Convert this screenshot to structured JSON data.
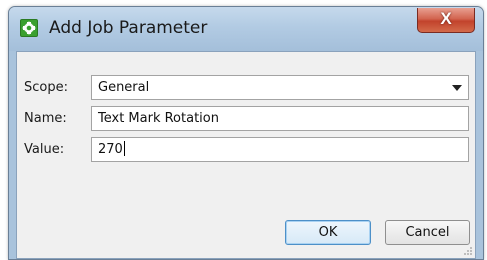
{
  "window": {
    "title": "Add Job Parameter",
    "close_glyph": "X",
    "app_icon": "green-gear-icon"
  },
  "form": {
    "scope": {
      "label": "Scope:",
      "value": "General"
    },
    "name": {
      "label": "Name:",
      "value": "Text Mark Rotation"
    },
    "value": {
      "label": "Value:",
      "value": "270"
    }
  },
  "buttons": {
    "ok_label": "OK",
    "cancel_label": "Cancel"
  },
  "colors": {
    "titlebar": "#b2cbe3",
    "close_button": "#c2432c",
    "ok_border": "#4d90c8",
    "icon_green": "#3aa02f"
  }
}
